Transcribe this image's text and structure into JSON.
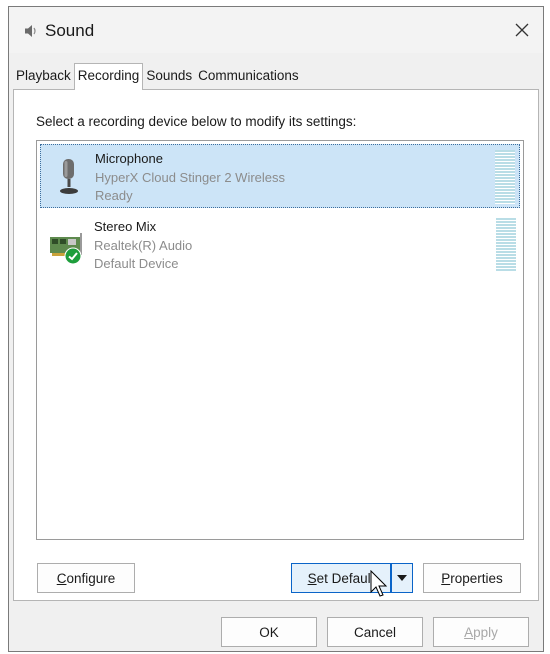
{
  "window": {
    "title": "Sound",
    "close_glyph": "✕"
  },
  "tabs": [
    {
      "label": "Playback",
      "active": false
    },
    {
      "label": "Recording",
      "active": true
    },
    {
      "label": "Sounds",
      "active": false
    },
    {
      "label": "Communications",
      "active": false
    }
  ],
  "recording": {
    "instruction": "Select a recording device below to modify its settings:",
    "devices": [
      {
        "name": "Microphone",
        "description": "HyperX Cloud Stinger 2 Wireless",
        "status": "Ready",
        "selected": true,
        "icon": "microphone-icon"
      },
      {
        "name": "Stereo Mix",
        "description": "Realtek(R) Audio",
        "status": "Default Device",
        "selected": false,
        "icon": "sound-card-icon",
        "badge": "default-check-icon"
      }
    ]
  },
  "buttons": {
    "configure": {
      "label_underlined": "C",
      "label_rest": "onfigure"
    },
    "set_default": {
      "label_underlined": "S",
      "label_rest": "et Default"
    },
    "properties": {
      "label_underlined": "P",
      "label_rest": "roperties"
    },
    "ok": "OK",
    "cancel": "Cancel",
    "apply": {
      "label_underlined": "A",
      "label_rest": "pply"
    }
  },
  "colors": {
    "selection": "#cce4f7",
    "focus_border": "#0a64c8",
    "default_badge": "#1e9e3c",
    "level_meter": "#b9dde6"
  }
}
